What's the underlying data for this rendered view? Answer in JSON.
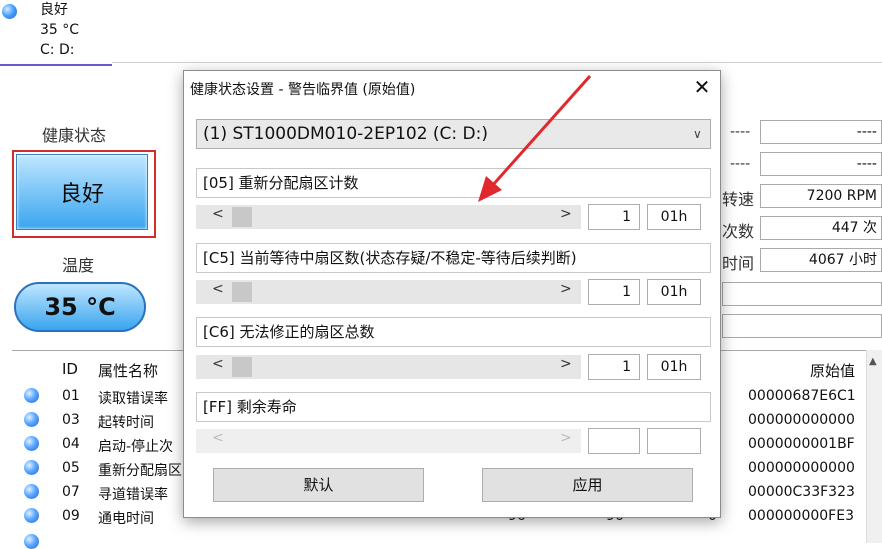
{
  "drive_tab": {
    "status": "良好",
    "temperature": "35 °C",
    "letters": "C: D:"
  },
  "left_panel": {
    "health_label": "健康状态",
    "health_value": "良好",
    "temp_label": "温度",
    "temp_value": "35 °C"
  },
  "right_panel": {
    "rows": [
      {
        "label": "----",
        "value": "----"
      },
      {
        "label": "----",
        "value": "----"
      },
      {
        "label": "转速",
        "value": "7200 RPM"
      },
      {
        "label": "次数",
        "value": "447 次"
      },
      {
        "label": "时间",
        "value": "4067 小时"
      }
    ]
  },
  "table": {
    "headers": {
      "id": "ID",
      "name": "属性名称",
      "raw": "原始值"
    },
    "rows": [
      {
        "id": "01",
        "name": "读取错误率",
        "raw": "00000687E6C1"
      },
      {
        "id": "03",
        "name": "起转时间",
        "raw": "000000000000"
      },
      {
        "id": "04",
        "name": "启动-停止次",
        "raw": "0000000001BF"
      },
      {
        "id": "05",
        "name": "重新分配扇区",
        "raw": "000000000000"
      },
      {
        "id": "07",
        "name": "寻道错误率",
        "raw": "00000C33F323"
      },
      {
        "id": "09",
        "name": "通电时间",
        "cur": "96",
        "worst": "96",
        "thr": "0",
        "raw": "000000000FE3"
      }
    ]
  },
  "dialog": {
    "title": "健康状态设置 - 警告临界值 (原始值)",
    "drive": "(1) ST1000DM010-2EP102  (C: D:)",
    "sections": [
      {
        "label": "[05] 重新分配扇区计数",
        "value": "1",
        "hex": "01h"
      },
      {
        "label": "[C5] 当前等待中扇区数(状态存疑/不稳定-等待后续判断)",
        "value": "1",
        "hex": "01h"
      },
      {
        "label": "[C6] 无法修正的扇区总数",
        "value": "1",
        "hex": "01h"
      },
      {
        "label": "[FF] 剩余寿命",
        "value": "",
        "hex": ""
      }
    ],
    "default_btn": "默认",
    "apply_btn": "应用",
    "close": "✕"
  },
  "colors": {
    "highlight_border": "#d12b2b",
    "accent_blue": "#39a5ee",
    "arrow_red": "#e0282e"
  }
}
